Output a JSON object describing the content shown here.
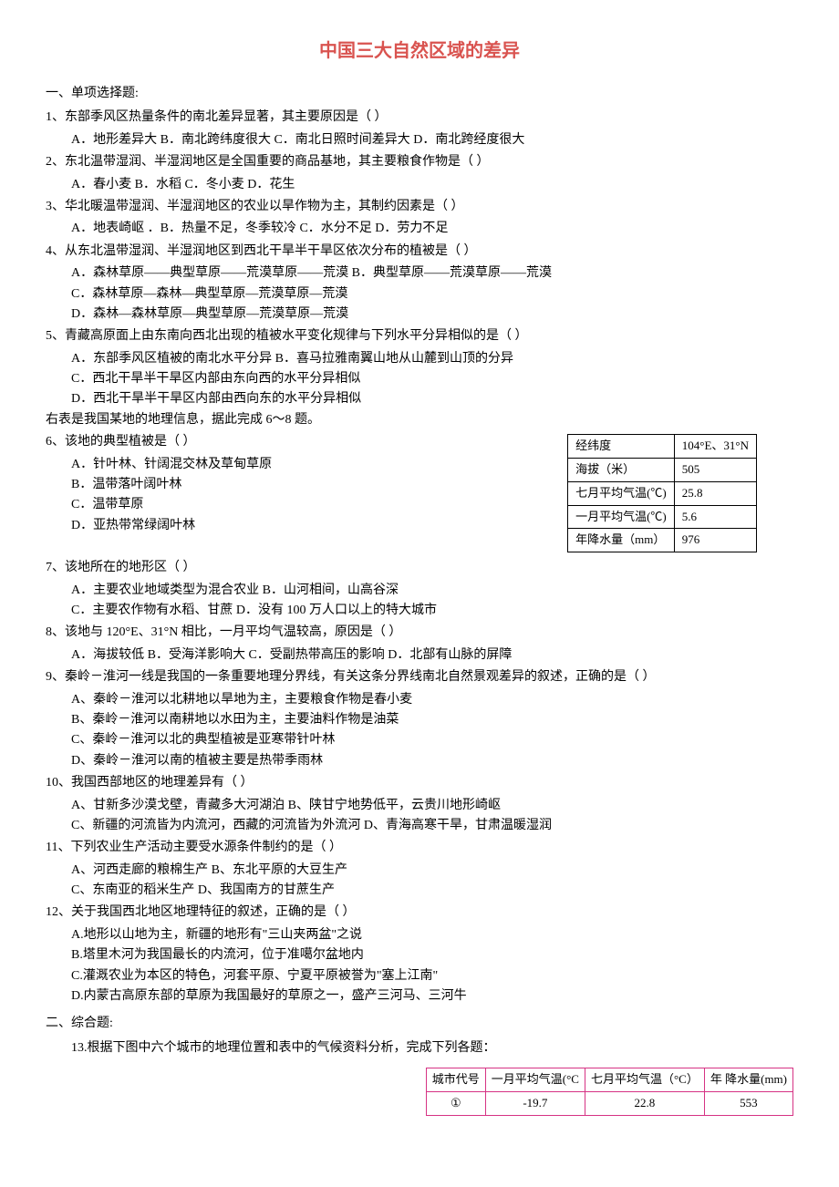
{
  "title": "中国三大自然区域的差异",
  "section1": "一、单项选择题:",
  "q1": {
    "text": "1、东部季风区热量条件的南北差异显著，其主要原因是（    ）",
    "opts": "A．地形差异大    B．南北跨纬度很大    C．南北日照时间差异大    D．南北跨经度很大"
  },
  "q2": {
    "text": "2、东北温带湿润、半湿润地区是全国重要的商品基地，其主要粮食作物是（    ）",
    "opts": "A．春小麦       B．水稻        C．冬小麦         D．花生"
  },
  "q3": {
    "text": "3、华北暖温带湿润、半湿润地区的农业以旱作物为主，其制约因素是（    ）",
    "opts": "A．地表崎岖    ．B．热量不足，冬季较冷    C．水分不足       D．劳力不足"
  },
  "q4": {
    "text": "4、从东北温带湿润、半湿润地区到西北干旱半干旱区依次分布的植被是（    ）",
    "optA": "A．森林草原——典型草原——荒漠草原——荒漠  B．典型草原——荒漠草原——荒漠",
    "optC": "C．森林草原—森林—典型草原—荒漠草原—荒漠",
    "optD": "D．森林—森林草原—典型草原—荒漠草原—荒漠"
  },
  "q5": {
    "text": "5、青藏高原面上由东南向西北出现的植被水平变化规律与下列水平分异相似的是（    ）",
    "optA": "A．东部季风区植被的南北水平分异        B．喜马拉雅南翼山地从山麓到山顶的分异",
    "optC": "C．西北干旱半干旱区内部由东向西的水平分异相似",
    "optD": "D．西北干旱半干旱区内部由西向东的水平分异相似"
  },
  "tableIntro": "右表是我国某地的地理信息，据此完成 6～8 题。",
  "dataTable": {
    "rows": [
      [
        "经纬度",
        "104°E、31°N"
      ],
      [
        "海拔（米）",
        "505"
      ],
      [
        "七月平均气温(℃)",
        "25.8"
      ],
      [
        "一月平均气温(℃)",
        "5.6"
      ],
      [
        "年降水量（mm）",
        "976"
      ]
    ]
  },
  "q6": {
    "text": "6、该地的典型植被是（     ）",
    "optA": "A．针叶林、针阔混交林及草甸草原",
    "optB": "B．温带落叶阔叶林",
    "optC": "C．温带草原",
    "optD": "D．亚热带常绿阔叶林"
  },
  "q7": {
    "text": "7、该地所在的地形区（     ）",
    "optA": "A．主要农业地域类型为混合农业       B．山河相间，山高谷深",
    "optC": "C．主要农作物有水稻、甘蔗           D．没有 100 万人口以上的特大城市"
  },
  "q8": {
    "text": "8、该地与 120°E、31°N 相比，一月平均气温较高，原因是（    ）",
    "opts": "A．海拔较低    B．受海洋影响大    C．受副热带高压的影响    D．北部有山脉的屏障"
  },
  "q9": {
    "text": "9、秦岭－淮河一线是我国的一条重要地理分界线，有关这条分界线南北自然景观差异的叙述，正确的是（    ）",
    "optA": "A、秦岭－淮河以北耕地以旱地为主，主要粮食作物是春小麦",
    "optB": "B、秦岭－淮河以南耕地以水田为主，主要油料作物是油菜",
    "optC": "C、秦岭－淮河以北的典型植被是亚寒带针叶林",
    "optD": "D、秦岭－淮河以南的植被主要是热带季雨林"
  },
  "q10": {
    "text": "10、我国西部地区的地理差异有（    ）",
    "optA": "A、甘新多沙漠戈壁，青藏多大河湖泊          B、陕甘宁地势低平，云贵川地形崎岖",
    "optC": "C、新疆的河流皆为内流河，西藏的河流皆为外流河  D、青海高寒干旱，甘肃温暖湿润"
  },
  "q11": {
    "text": "11、下列农业生产活动主要受水源条件制约的是（    ）",
    "optA": "A、河西走廊的粮棉生产           B、东北平原的大豆生产",
    "optC": "C、东南亚的稻米生产             D、我国南方的甘蔗生产"
  },
  "q12": {
    "text": "12、关于我国西北地区地理特征的叙述，正确的是（    ）",
    "optA": "A.地形以山地为主，新疆的地形有\"三山夹两盆\"之说",
    "optB": "B.塔里木河为我国最长的内流河，位于准噶尔盆地内",
    "optC": "C.灌溉农业为本区的特色，河套平原、宁夏平原被誉为\"塞上江南\"",
    "optD": "D.内蒙古高原东部的草原为我国最好的草原之一，盛产三河马、三河牛"
  },
  "section2": "二、综合题:",
  "q13": {
    "text": "13.根据下图中六个城市的地理位置和表中的气候资料分析，完成下列各题："
  },
  "climateTable": {
    "headers": [
      "城市代号",
      "一月平均气温(°C",
      "七月平均气温（°C）",
      "年   降水量(mm)"
    ],
    "row1": [
      "①",
      "-19.7",
      "22.8",
      "553"
    ]
  }
}
